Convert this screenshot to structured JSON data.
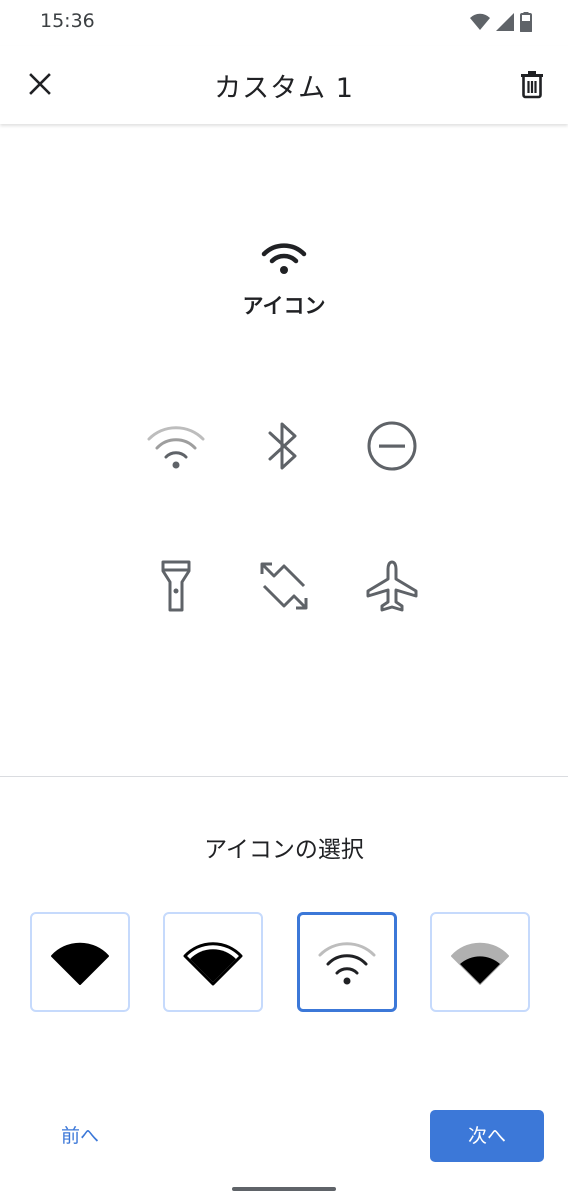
{
  "status": {
    "time": "15:36"
  },
  "appbar": {
    "title": "カスタム 1"
  },
  "preview": {
    "icon": "wifi-icon",
    "label": "アイコン"
  },
  "tiles": [
    "wifi-icon",
    "bluetooth-icon",
    "do-not-disturb-icon",
    "flashlight-icon",
    "auto-rotate-icon",
    "airplane-icon"
  ],
  "selector": {
    "title": "アイコンの選択",
    "options": [
      "wifi-wedge-solid-icon",
      "wifi-wedge-filled-icon",
      "wifi-outline-icon",
      "wifi-wedge-partial-icon"
    ],
    "selected_index": 2
  },
  "footer": {
    "prev_label": "前へ",
    "next_label": "次へ"
  },
  "colors": {
    "accent": "#3c78d8",
    "option_border": "#c6dafc",
    "icon_gray": "#5f6368"
  }
}
